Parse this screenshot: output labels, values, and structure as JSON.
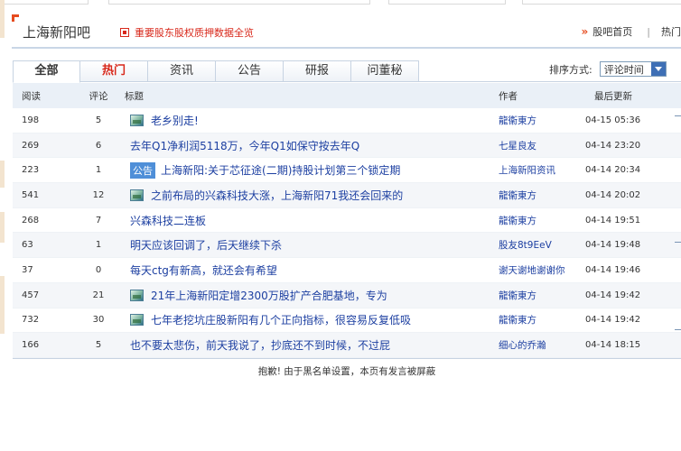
{
  "header": {
    "bar_title": "上海新阳吧",
    "notice": "重要股东股权质押数据全览",
    "home_link": "股吧首页",
    "hot_link": "热门"
  },
  "tabs": [
    {
      "label": "全部"
    },
    {
      "label": "热门"
    },
    {
      "label": "资讯"
    },
    {
      "label": "公告"
    },
    {
      "label": "研报"
    },
    {
      "label": "问董秘"
    }
  ],
  "sort": {
    "label": "排序方式:",
    "value": "评论时间"
  },
  "columns": {
    "read": "阅读",
    "comments": "评论",
    "title": "标题",
    "author": "作者",
    "updated": "最后更新"
  },
  "posts": [
    {
      "read": "198",
      "comments": "5",
      "title": "老乡别走!",
      "author": "龍衞東方",
      "time": "04-15 05:36",
      "icon": "image-icon"
    },
    {
      "read": "269",
      "comments": "6",
      "title": "去年Q1净利润5118万，今年Q1如保守按去年Q",
      "author": "七星良友",
      "time": "04-14 23:20",
      "icon": ""
    },
    {
      "read": "223",
      "comments": "1",
      "title": "上海新阳:关于芯征途(二期)持股计划第三个锁定期",
      "author": "上海新阳资讯",
      "time": "04-14 20:34",
      "icon": "announcement-badge",
      "badge": "公告"
    },
    {
      "read": "541",
      "comments": "12",
      "title": "之前布局的兴森科技大涨，上海新阳71我还会回来的",
      "author": "龍衞東方",
      "time": "04-14 20:02",
      "icon": "image-icon"
    },
    {
      "read": "268",
      "comments": "7",
      "title": "兴森科技二连板",
      "author": "龍衞東方",
      "time": "04-14 19:51",
      "icon": ""
    },
    {
      "read": "63",
      "comments": "1",
      "title": "明天应该回调了，后天继续下杀",
      "author": "股友8t9EeV",
      "time": "04-14 19:48",
      "icon": ""
    },
    {
      "read": "37",
      "comments": "0",
      "title": "每天ctg有新高，就还会有希望",
      "author": "谢天谢地谢谢你",
      "time": "04-14 19:46",
      "icon": ""
    },
    {
      "read": "457",
      "comments": "21",
      "title": "21年上海新阳定增2300万股扩产合肥基地，专为",
      "author": "龍衞東方",
      "time": "04-14 19:42",
      "icon": "image-icon"
    },
    {
      "read": "732",
      "comments": "30",
      "title": "七年老挖坑庄股新阳有几个正向指标，很容易反复低吸",
      "author": "龍衞東方",
      "time": "04-14 19:42",
      "icon": "image-icon"
    },
    {
      "read": "166",
      "comments": "5",
      "title": "也不要太悲伤，前天我说了，抄底还不到时候，不过屁",
      "author": "细心的乔瀚",
      "time": "04-14 18:15",
      "icon": ""
    }
  ],
  "footer_note": "抱歉! 由于黑名单设置，本页有发言被屏蔽",
  "colors": {
    "accent_red": "#d8281b",
    "link_blue": "#1c3fa1",
    "tab_border": "#c7d3e2",
    "header_bg": "#eaf0f7"
  }
}
